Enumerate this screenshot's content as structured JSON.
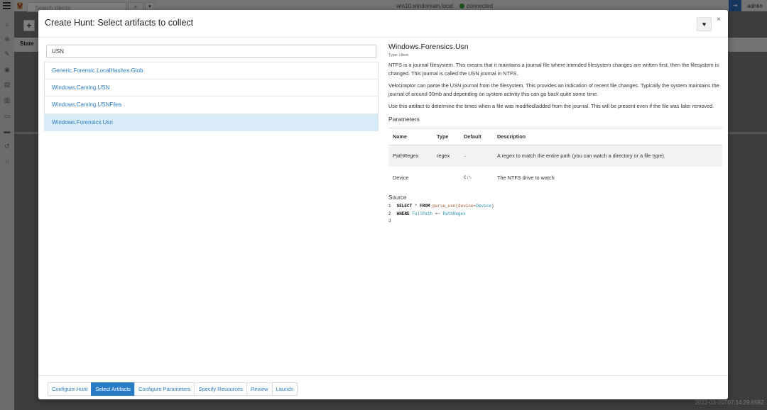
{
  "background": {
    "search_placeholder": "Search clients",
    "search_icon": "search-icon",
    "hostname": "win10.windomain.local",
    "connection_status": "connected",
    "username": "admin",
    "add_label": "+",
    "state_header": "State",
    "timestamp": "2022-03-20T07:14:29.658Z",
    "colors": {
      "connected": "#3aa63a",
      "accent": "#2a7cc7"
    }
  },
  "modal": {
    "title": "Create Hunt: Select artifacts to collect",
    "favorite_icon": "heart-icon",
    "close_label": "×",
    "search": {
      "value": "USN"
    },
    "artifacts": [
      {
        "name": "Generic.Forensic.LocalHashes.Glob",
        "selected": false
      },
      {
        "name": "Windows.Carving.USN",
        "selected": false
      },
      {
        "name": "Windows.Carving.USNFiles",
        "selected": false
      },
      {
        "name": "Windows.Forensics.Usn",
        "selected": true
      }
    ],
    "detail": {
      "title": "Windows.Forensics.Usn",
      "type": "Type: client",
      "paragraphs": [
        "NTFS is a journal filesystem. This means that it maintains a journal file where intended filesystem changes are written first, then the filesystem is changed. This journal is called the USN journal in NTFS.",
        "Velociraptor can parse the USN journal from the filesystem. This provides an indication of recent file changes. Typically the system maintains the journal of around 30mb and depending on system activity this can go back quite some time.",
        "Use this artifact to determine the times when a file was modified/added from the journal. This will be present even if the file was later removed."
      ],
      "parameters_heading": "Parameters",
      "param_columns": [
        "Name",
        "Type",
        "Default",
        "Description"
      ],
      "params": [
        {
          "name": "PathRegex",
          "type": "regex",
          "default": ".",
          "description": "A regex to match the entire path (you can watch a directory or a file type)."
        },
        {
          "name": "Device",
          "type": "",
          "default": "C:\\",
          "description": "The NTFS drive to watch"
        }
      ],
      "source_heading": "Source",
      "source_lines": [
        "1",
        "2",
        "3"
      ],
      "code": {
        "select": "SELECT",
        "star": " * ",
        "from": "FROM",
        "fn": " parse_usn(",
        "arg": "device=",
        "argval": "Device",
        "close": ")",
        "where": "WHERE",
        "field": " FullPath",
        "op": " =~ ",
        "regex": "PathRegex"
      }
    },
    "steps": [
      {
        "label": "Configure Hunt",
        "active": false
      },
      {
        "label": "Select Artifacts",
        "active": true
      },
      {
        "label": "Configure Parameters",
        "active": false
      },
      {
        "label": "Specify Resources",
        "active": false
      },
      {
        "label": "Review",
        "active": false
      },
      {
        "label": "Launch",
        "active": false
      }
    ]
  }
}
